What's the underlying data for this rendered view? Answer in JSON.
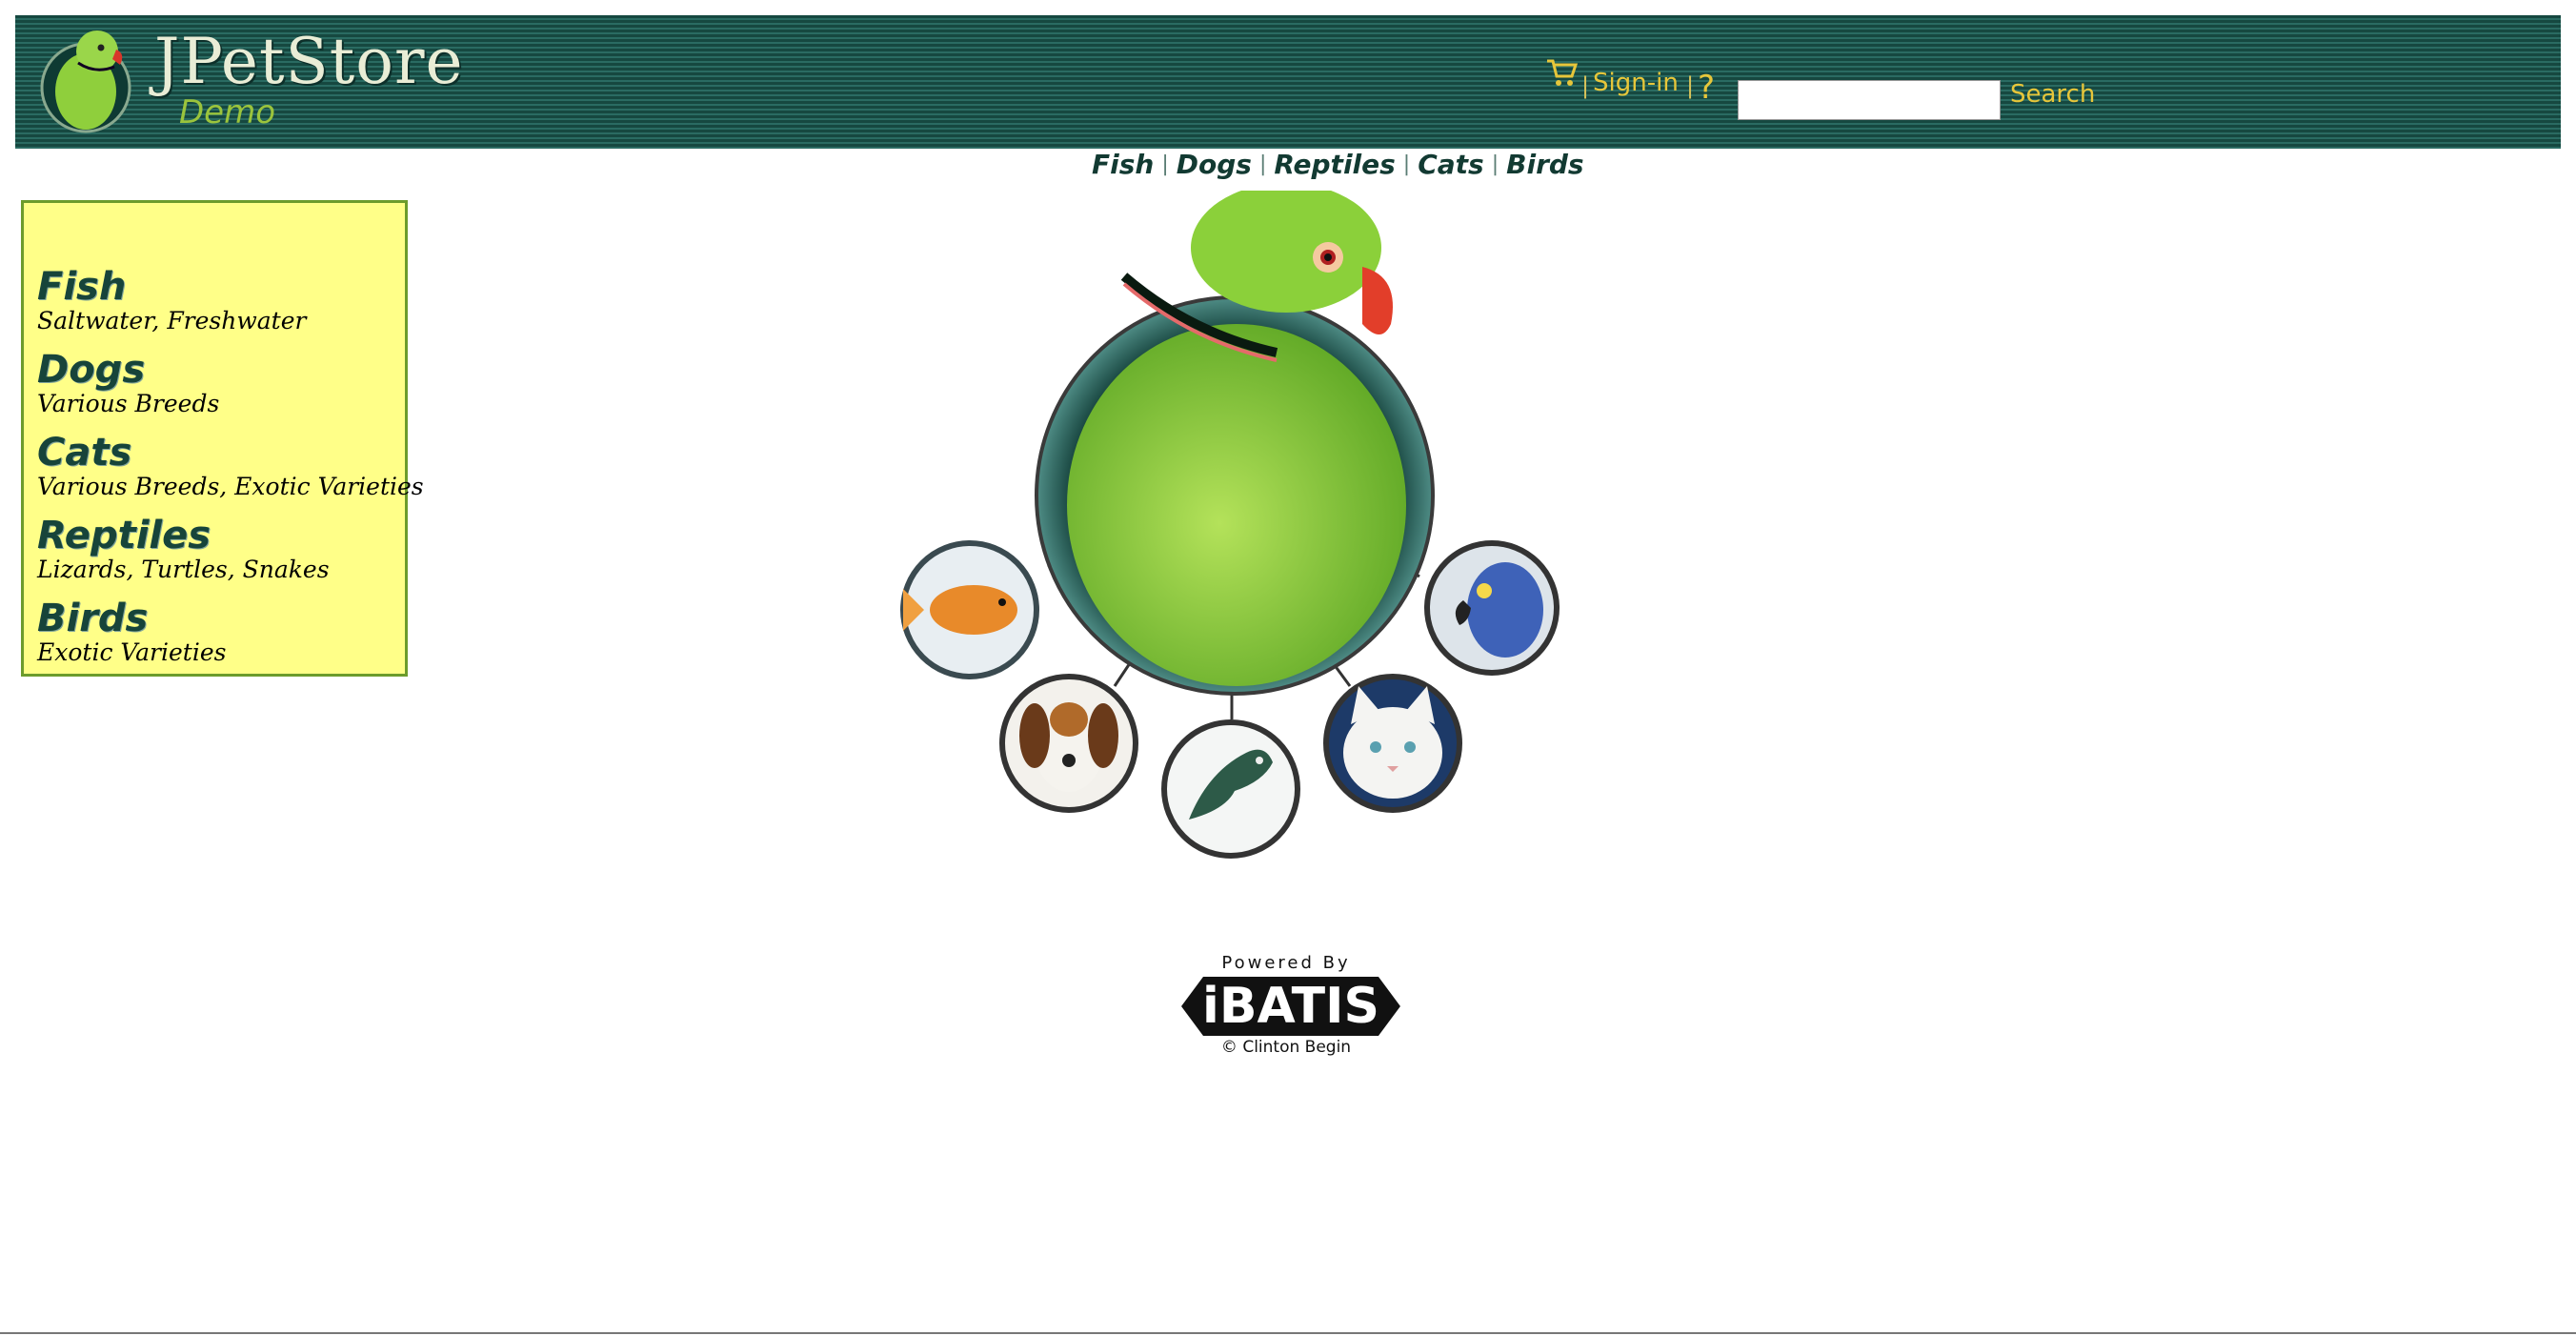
{
  "header": {
    "logo": {
      "title": "JPetStore",
      "subtitle": "Demo"
    },
    "sign_in": "Sign-in",
    "separator": "|",
    "help_icon": "?",
    "search": {
      "value": "",
      "placeholder": "",
      "button": "Search"
    },
    "colors": {
      "bar": "#1f5a52",
      "link": "#e7c63a"
    }
  },
  "quicklinks": [
    "Fish",
    "Dogs",
    "Reptiles",
    "Cats",
    "Birds"
  ],
  "sidebar": {
    "items": [
      {
        "name": "Fish",
        "desc": "Saltwater, Freshwater"
      },
      {
        "name": "Dogs",
        "desc": "Various Breeds"
      },
      {
        "name": "Cats",
        "desc": "Various Breeds, Exotic Varieties"
      },
      {
        "name": "Reptiles",
        "desc": "Lizards, Turtles, Snakes"
      },
      {
        "name": "Birds",
        "desc": "Exotic Varieties"
      }
    ],
    "colors": {
      "background": "#ffff88",
      "border": "#6c9c2c"
    }
  },
  "hero": {
    "icons": [
      "parrot-image",
      "fish-image",
      "dog-image",
      "reptile-image",
      "cat-image",
      "bird-image"
    ]
  },
  "footer": {
    "powered_by": "Powered By",
    "brand": "iBATIS",
    "copyright": "© Clinton Begin"
  }
}
